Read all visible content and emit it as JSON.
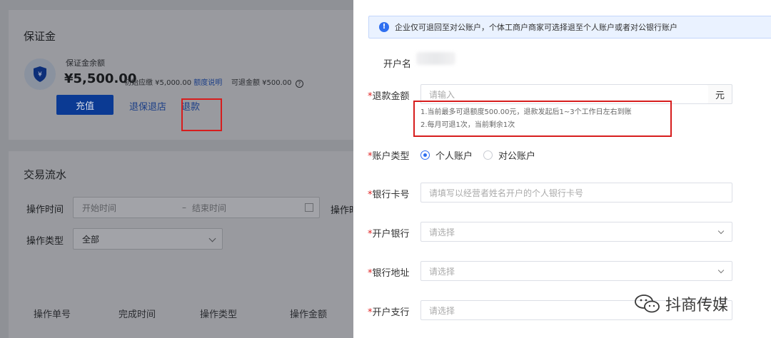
{
  "deposit": {
    "title": "保证金",
    "balance_label": "保证金余额",
    "balance_amount": "¥5,500.00",
    "initial_text": "初始应缴 ¥5,000.00",
    "quota_link": "额度说明",
    "refundable_text": "可退金额 ¥500.00",
    "help_icon_glyph": "?",
    "recharge_button": "充值",
    "quit_link": "退保退店",
    "refund_link": "退款",
    "highlight_color": "#d71d1d"
  },
  "flow": {
    "title": "交易流水",
    "op_time_label": "操作时间",
    "start_placeholder": "开始时间",
    "range_sep": "–",
    "end_placeholder": "结束时间",
    "cut_label": "操作时",
    "op_type_label": "操作类型",
    "op_type_value": "全部",
    "columns": [
      "操作单号",
      "完成时间",
      "操作类型",
      "操作金额"
    ]
  },
  "drawer": {
    "notice": "企业仅可退回至对公账户，个体工商户商家可选择退至个人账户或者对公银行账户",
    "notice_icon_glyph": "!",
    "close_glyph": "×",
    "account_name_label": "开户名",
    "required_mark": "*",
    "refund_amount_label": "退款金额",
    "refund_amount_placeholder": "请输入",
    "unit": "元",
    "hint_1": "1.当前最多可退额度500.00元，退款发起后1~3个工作日左右到账",
    "hint_2": "2.每月可退1次，当前剩余1次",
    "account_type_label": "账户类型",
    "account_type_options": [
      "个人账户",
      "对公账户"
    ],
    "account_type_selected": "个人账户",
    "card_no_label": "银行卡号",
    "card_no_placeholder": "请填写以经营者姓名开户的个人银行卡号",
    "bank_label": "开户银行",
    "bank_placeholder": "请选择",
    "bank_address_label": "银行地址",
    "bank_address_placeholder": "请选择",
    "branch_label": "开户支行",
    "branch_placeholder": "请选择",
    "accent_color": "#2f6ff0"
  },
  "watermark": {
    "text": "抖商传媒"
  }
}
